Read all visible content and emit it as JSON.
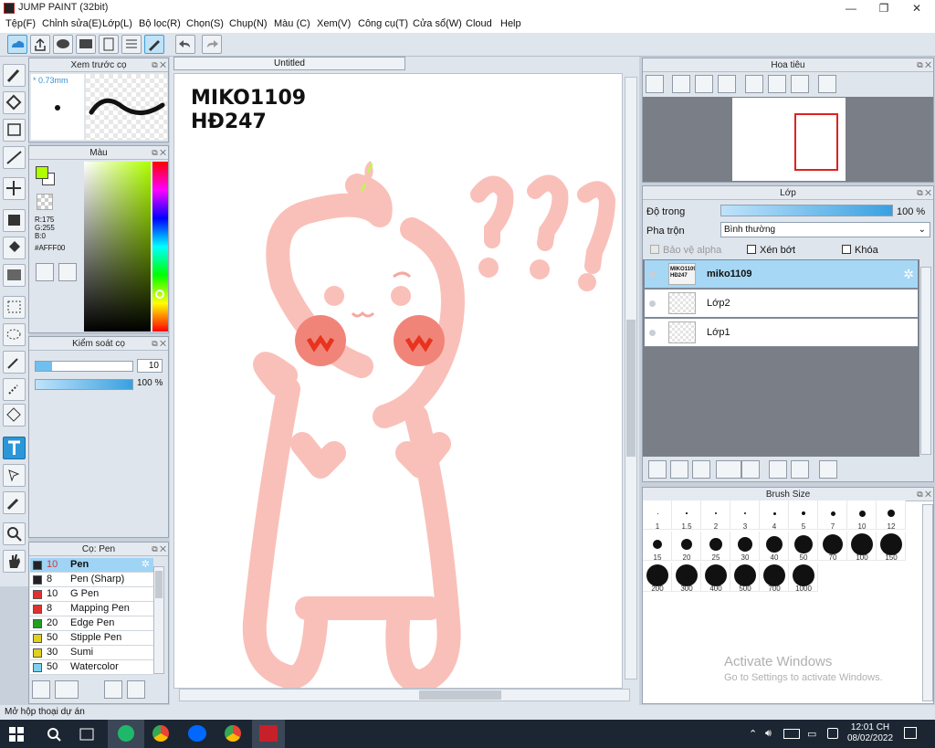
{
  "window": {
    "title": "JUMP PAINT (32bit)",
    "controls": [
      "—",
      "❐",
      "✕"
    ]
  },
  "menu": [
    "Tệp(F)",
    "Chỉnh sửa(E)",
    "Lớp(L)",
    "Bộ lọc(R)",
    "Chọn(S)",
    "Chụp(N)",
    "Màu (C)",
    "Xem(V)",
    "Công cụ(T)",
    "Cửa sổ(W)",
    "Cloud",
    "Help"
  ],
  "preview": {
    "title": "Xem trước cọ",
    "size": "* 0.73mm"
  },
  "color": {
    "title": "Màu",
    "r": "R:175",
    "g": "G:255",
    "b": "B:0",
    "hex": "#AFFF00",
    "swatch": "#AFFF00"
  },
  "brush_control": {
    "title": "Kiểm soát cọ",
    "size": "10",
    "opacity": "100 %"
  },
  "brush_list": {
    "title": "Cọ: Pen",
    "items": [
      {
        "num": "10",
        "label": "Pen",
        "color": "#222222"
      },
      {
        "num": "8",
        "label": "Pen (Sharp)",
        "color": "#222222"
      },
      {
        "num": "10",
        "label": "G Pen",
        "color": "#e03030"
      },
      {
        "num": "8",
        "label": "Mapping Pen",
        "color": "#e03030"
      },
      {
        "num": "20",
        "label": "Edge Pen",
        "color": "#20a020"
      },
      {
        "num": "50",
        "label": "Stipple Pen",
        "color": "#e0d020"
      },
      {
        "num": "30",
        "label": "Sumi",
        "color": "#e0d020"
      },
      {
        "num": "50",
        "label": "Watercolor",
        "color": "#7fd0f0"
      }
    ]
  },
  "document": {
    "tab": "Untitled",
    "line1": "MIKO1109",
    "line2": "HĐ247",
    "question": "???"
  },
  "navigator": {
    "title": "Hoa tiêu"
  },
  "layers": {
    "title": "Lớp",
    "opacity_label": "Độ trong",
    "opacity_value": "100 %",
    "blend_label": "Pha trộn",
    "blend_value": "Bình thường",
    "protect_alpha": "Bảo vệ alpha",
    "clipping": "Xén bớt",
    "lock": "Khóa",
    "items": [
      {
        "name": "miko1109",
        "thumb": "MIKO1109 HĐ247"
      },
      {
        "name": "Lớp2"
      },
      {
        "name": "Lớp1"
      }
    ]
  },
  "brush_size": {
    "title": "Brush Size",
    "sizes": [
      "1",
      "1.5",
      "2",
      "3",
      "4",
      "5",
      "7",
      "10",
      "12",
      "15",
      "20",
      "25",
      "30",
      "40",
      "50",
      "70",
      "100",
      "150",
      "200",
      "300",
      "400",
      "500",
      "700",
      "1000"
    ]
  },
  "watermark": {
    "line1": "Activate Windows",
    "line2": "Go to Settings to activate Windows."
  },
  "status": "Mở hộp thoại dự án",
  "taskbar": {
    "time": "12:01 CH",
    "date": "08/02/2022"
  }
}
